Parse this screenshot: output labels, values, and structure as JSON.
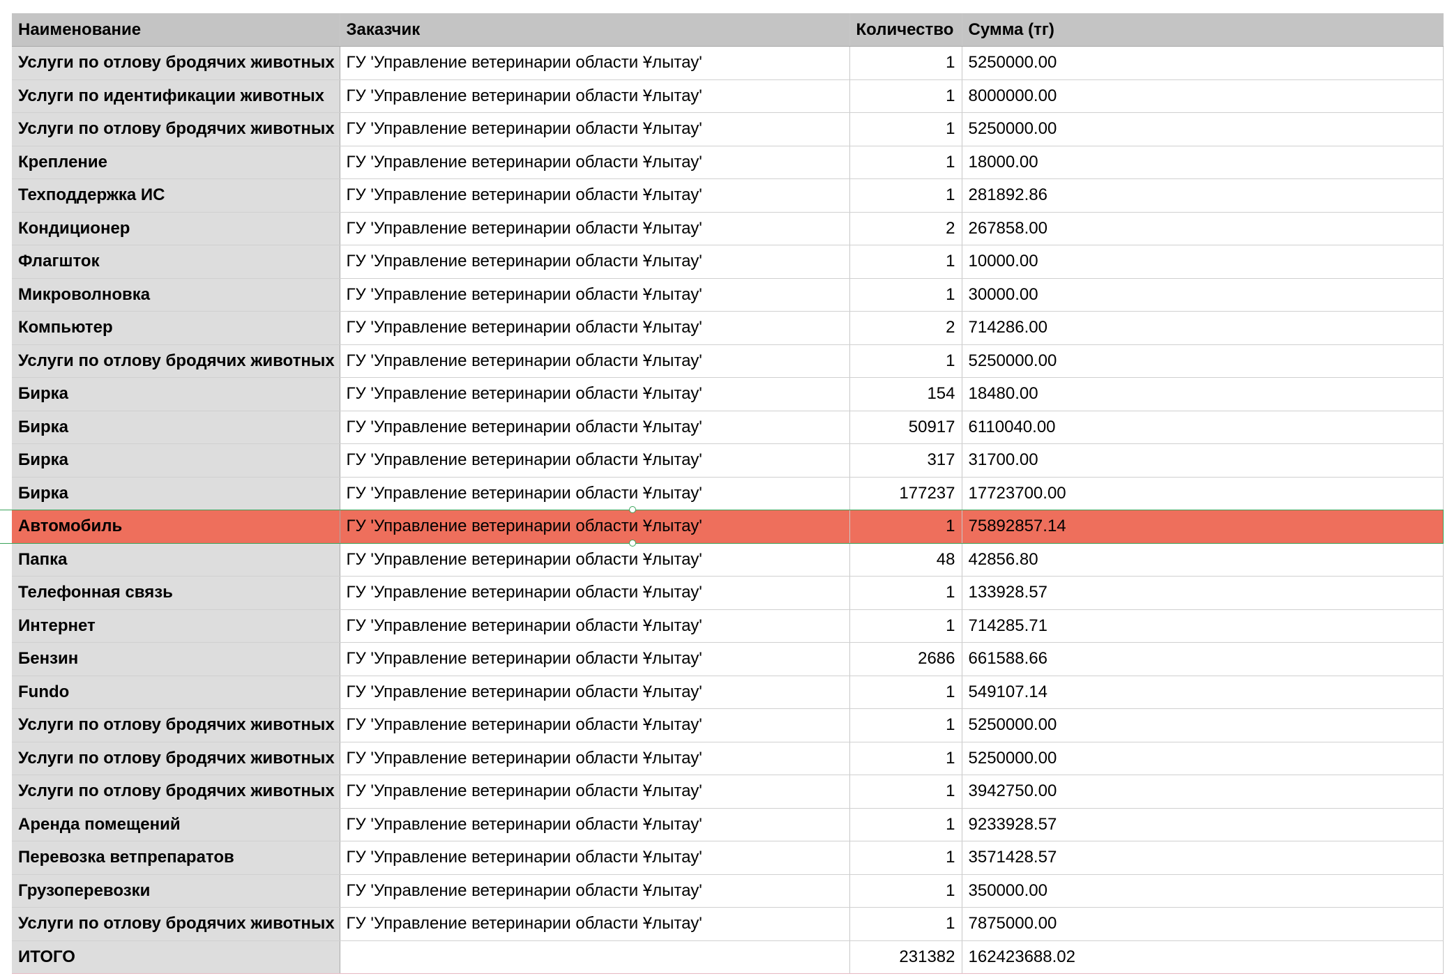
{
  "table": {
    "headers": {
      "name": "Наименование",
      "customer": "Заказчик",
      "quantity": "Количество",
      "sum": "Сумма (тг)"
    },
    "rows": [
      {
        "name": "Услуги по отлову бродячих животных",
        "customer": "ГУ 'Управление ветеринарии области Ұлытау'",
        "quantity": "1",
        "sum": "5250000.00"
      },
      {
        "name": "Услуги по идентификации животных",
        "customer": "ГУ 'Управление ветеринарии области Ұлытау'",
        "quantity": "1",
        "sum": "8000000.00"
      },
      {
        "name": "Услуги по отлову бродячих животных",
        "customer": "ГУ 'Управление ветеринарии области Ұлытау'",
        "quantity": "1",
        "sum": "5250000.00"
      },
      {
        "name": "Крепление",
        "customer": "ГУ 'Управление ветеринарии области Ұлытау'",
        "quantity": "1",
        "sum": "18000.00"
      },
      {
        "name": "Техподдержка ИС",
        "customer": "ГУ 'Управление ветеринарии области Ұлытау'",
        "quantity": "1",
        "sum": "281892.86"
      },
      {
        "name": "Кондиционер",
        "customer": "ГУ 'Управление ветеринарии области Ұлытау'",
        "quantity": "2",
        "sum": "267858.00"
      },
      {
        "name": "Флагшток",
        "customer": "ГУ 'Управление ветеринарии области Ұлытау'",
        "quantity": "1",
        "sum": "10000.00"
      },
      {
        "name": "Микроволновка",
        "customer": "ГУ 'Управление ветеринарии области Ұлытау'",
        "quantity": "1",
        "sum": "30000.00"
      },
      {
        "name": "Компьютер",
        "customer": "ГУ 'Управление ветеринарии области Ұлытау'",
        "quantity": "2",
        "sum": "714286.00"
      },
      {
        "name": "Услуги по отлову бродячих животных",
        "customer": "ГУ 'Управление ветеринарии области Ұлытау'",
        "quantity": "1",
        "sum": "5250000.00"
      },
      {
        "name": "Бирка",
        "customer": "ГУ 'Управление ветеринарии области Ұлытау'",
        "quantity": "154",
        "sum": "18480.00"
      },
      {
        "name": "Бирка",
        "customer": "ГУ 'Управление ветеринарии области Ұлытау'",
        "quantity": "50917",
        "sum": "6110040.00"
      },
      {
        "name": "Бирка",
        "customer": "ГУ 'Управление ветеринарии области Ұлытау'",
        "quantity": "317",
        "sum": "31700.00"
      },
      {
        "name": "Бирка",
        "customer": "ГУ 'Управление ветеринарии области Ұлытау'",
        "quantity": "177237",
        "sum": "17723700.00"
      },
      {
        "name": "Автомобиль",
        "customer": "ГУ 'Управление ветеринарии области Ұлытау'",
        "quantity": "1",
        "sum": "75892857.14"
      },
      {
        "name": "Папка",
        "customer": "ГУ 'Управление ветеринарии области Ұлытау'",
        "quantity": "48",
        "sum": "42856.80"
      },
      {
        "name": "Телефонная связь",
        "customer": "ГУ 'Управление ветеринарии области Ұлытау'",
        "quantity": "1",
        "sum": "133928.57"
      },
      {
        "name": "Интернет",
        "customer": "ГУ 'Управление ветеринарии области Ұлытау'",
        "quantity": "1",
        "sum": "714285.71"
      },
      {
        "name": "Бензин",
        "customer": "ГУ 'Управление ветеринарии области Ұлытау'",
        "quantity": "2686",
        "sum": "661588.66"
      },
      {
        "name": "Fundo",
        "customer": "ГУ 'Управление ветеринарии области Ұлытау'",
        "quantity": "1",
        "sum": "549107.14"
      },
      {
        "name": "Услуги по отлову бродячих животных",
        "customer": "ГУ 'Управление ветеринарии области Ұлытау'",
        "quantity": "1",
        "sum": "5250000.00"
      },
      {
        "name": "Услуги по отлову бродячих животных",
        "customer": "ГУ 'Управление ветеринарии области Ұлытау'",
        "quantity": "1",
        "sum": "5250000.00"
      },
      {
        "name": "Услуги по отлову бродячих животных",
        "customer": "ГУ 'Управление ветеринарии области Ұлытау'",
        "quantity": "1",
        "sum": "3942750.00"
      },
      {
        "name": "Аренда помещений",
        "customer": "ГУ 'Управление ветеринарии области Ұлытау'",
        "quantity": "1",
        "sum": "9233928.57"
      },
      {
        "name": "Перевозка ветпрепаратов",
        "customer": "ГУ 'Управление ветеринарии области Ұлытау'",
        "quantity": "1",
        "sum": "3571428.57"
      },
      {
        "name": "Грузоперевозки",
        "customer": "ГУ 'Управление ветеринарии области Ұлытау'",
        "quantity": "1",
        "sum": "350000.00"
      },
      {
        "name": "Услуги по отлову бродячих животных",
        "customer": "ГУ 'Управление ветеринарии области Ұлытау'",
        "quantity": "1",
        "sum": "7875000.00"
      }
    ],
    "total": {
      "name": "ИТОГО",
      "customer": "",
      "quantity": "231382",
      "sum": "162423688.02"
    },
    "highlighted_row_index": 14,
    "highlight_color": "#ee6f5c",
    "header_color": "#c4c4c4",
    "name_column_color": "#dddddd",
    "selection_color": "#3aa35a"
  }
}
